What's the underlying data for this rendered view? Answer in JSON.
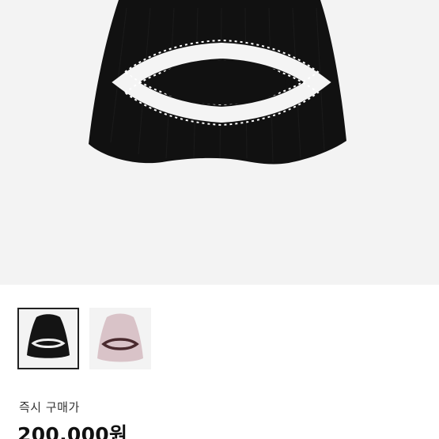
{
  "product": {
    "main_image_icon": "black-beanie-icon",
    "thumbnails": [
      {
        "icon": "black-beanie-thumb-icon",
        "selected": true,
        "color": "#141414"
      },
      {
        "icon": "pink-beanie-thumb-icon",
        "selected": false,
        "color": "#d9c3c8"
      }
    ]
  },
  "purchase": {
    "label": "즉시 구매가",
    "price": "200,000원"
  },
  "colors": {
    "background": "#f3f3f3",
    "selected_border": "#222222"
  }
}
